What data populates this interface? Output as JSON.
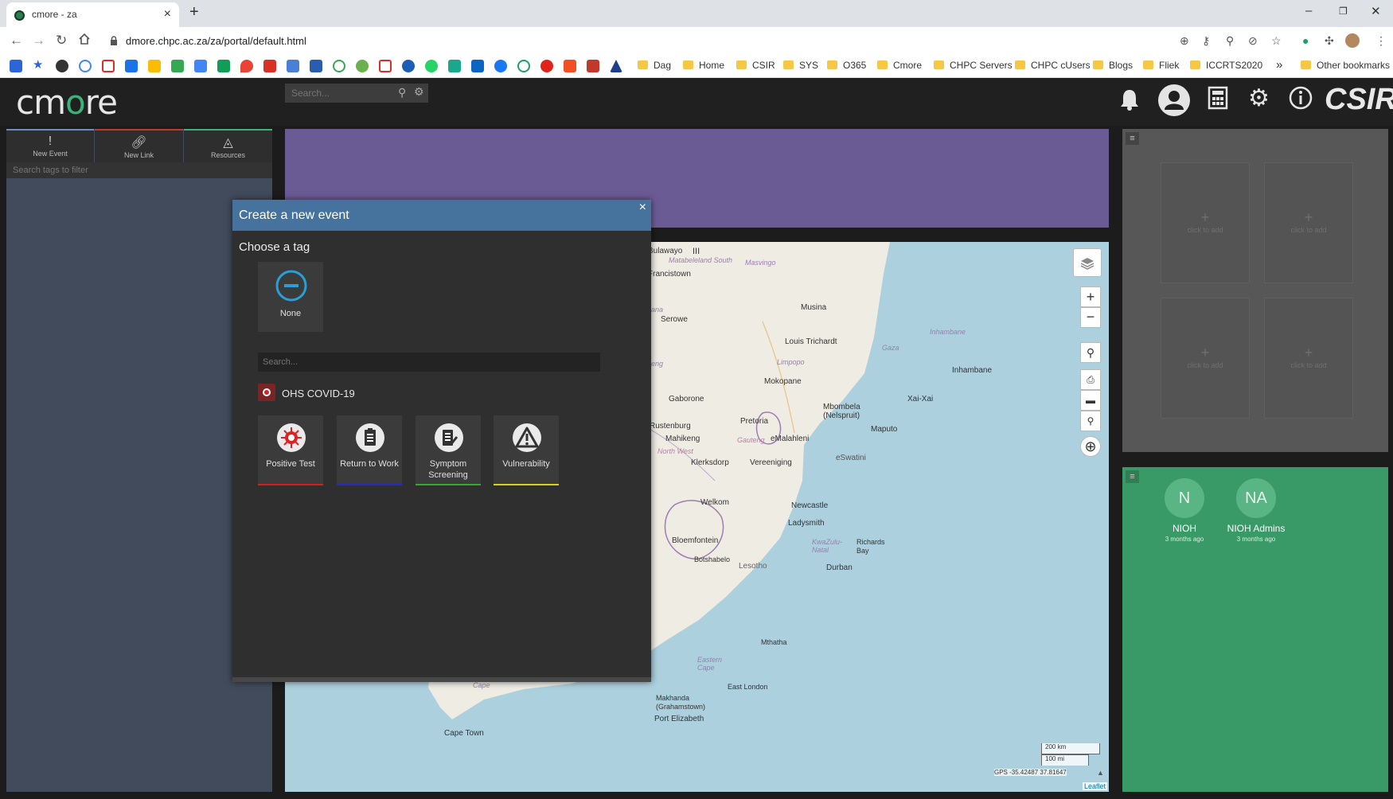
{
  "browser": {
    "tab_title": "cmore - za",
    "url": "dmore.chpc.ac.za/za/portal/default.html",
    "bookmarks": [
      "Dag",
      "Home",
      "CSIR",
      "SYS",
      "O365",
      "Cmore",
      "CHPC Servers",
      "CHPC cUsers",
      "Blogs",
      "Fliek",
      "ICCRTS2020"
    ],
    "other_bookmarks": "Other bookmarks",
    "colors": {
      "tab_bar": "#dee1e6",
      "toolbar": "#ffffff"
    }
  },
  "header": {
    "search_placeholder": "Search...",
    "icons": [
      "bell-icon",
      "user-icon",
      "calculator-icon",
      "gears-icon",
      "info-icon"
    ],
    "csir_logo": "CSIR"
  },
  "left_panel": {
    "buttons": [
      {
        "label": "New Event",
        "icon": "exclamation-icon",
        "accent": "#6b8cc4"
      },
      {
        "label": "New Link",
        "icon": "link-icon",
        "accent": "#c0392b"
      },
      {
        "label": "Resources",
        "icon": "resources-icon",
        "accent": "#3bb27a"
      }
    ],
    "filter_placeholder": "Search tags to filter"
  },
  "modal": {
    "title": "Create a new event",
    "choose_tag": "Choose a tag",
    "none_label": "None",
    "search_placeholder": "Search...",
    "group_name": "OHS COVID-19",
    "tags": [
      {
        "label": "Positive Test",
        "color": "#cc2222",
        "icon": "virus-icon"
      },
      {
        "label": "Return to Work",
        "color": "#2a2ab8",
        "icon": "clipboard-icon"
      },
      {
        "label": "Symptom Screening",
        "color": "#3aa63a",
        "icon": "checklist-icon"
      },
      {
        "label": "Vulnerability",
        "color": "#d4d21a",
        "icon": "warning-icon"
      }
    ]
  },
  "map": {
    "cities": [
      "Bulawayo",
      "Francistown",
      "Serowe",
      "Musina",
      "Louis Trichardt",
      "Mokopane",
      "Gaborone",
      "Rustenburg",
      "Pretoria",
      "eMalahleni",
      "Mbombela (Nelspruit)",
      "Maputo",
      "Inhambane",
      "Xai-Xai",
      "Mahikeng",
      "Klerksdorp",
      "Vereeniging",
      "eSwatini",
      "Welkom",
      "Newcastle",
      "Ladysmith",
      "Bloemfontein",
      "Botshabelo",
      "Lesotho",
      "Richards Bay",
      "Durban",
      "Mthatha",
      "East London",
      "Makhanda (Grahamstown)",
      "Port Elizabeth",
      "Cape Town"
    ],
    "regions": [
      "Matabeleland South",
      "Masvingo",
      "Limpopo",
      "Gaza",
      "Inhambane",
      "North West",
      "Gauteng",
      "KwaZulu-Natal",
      "Eastern Cape",
      "Cape",
      "ana",
      "eng"
    ],
    "scale_km": "200 km",
    "scale_mi": "100 mi",
    "gps": "GPS -35.42487 37.81647",
    "attribution": "Leaflet",
    "layer_toggle": "III"
  },
  "widgets": {
    "slot_label": "click to add",
    "slot_plus": "+"
  },
  "groups": [
    {
      "initials": "N",
      "name": "NIOH",
      "time": "3 months ago"
    },
    {
      "initials": "NA",
      "name": "NIOH Admins",
      "time": "3 months ago"
    }
  ],
  "colors": {
    "purple_banner": "#6b5b95",
    "group_panel": "#3a9a67",
    "modal_header": "#46739e",
    "left_panel": "#414b5b"
  }
}
